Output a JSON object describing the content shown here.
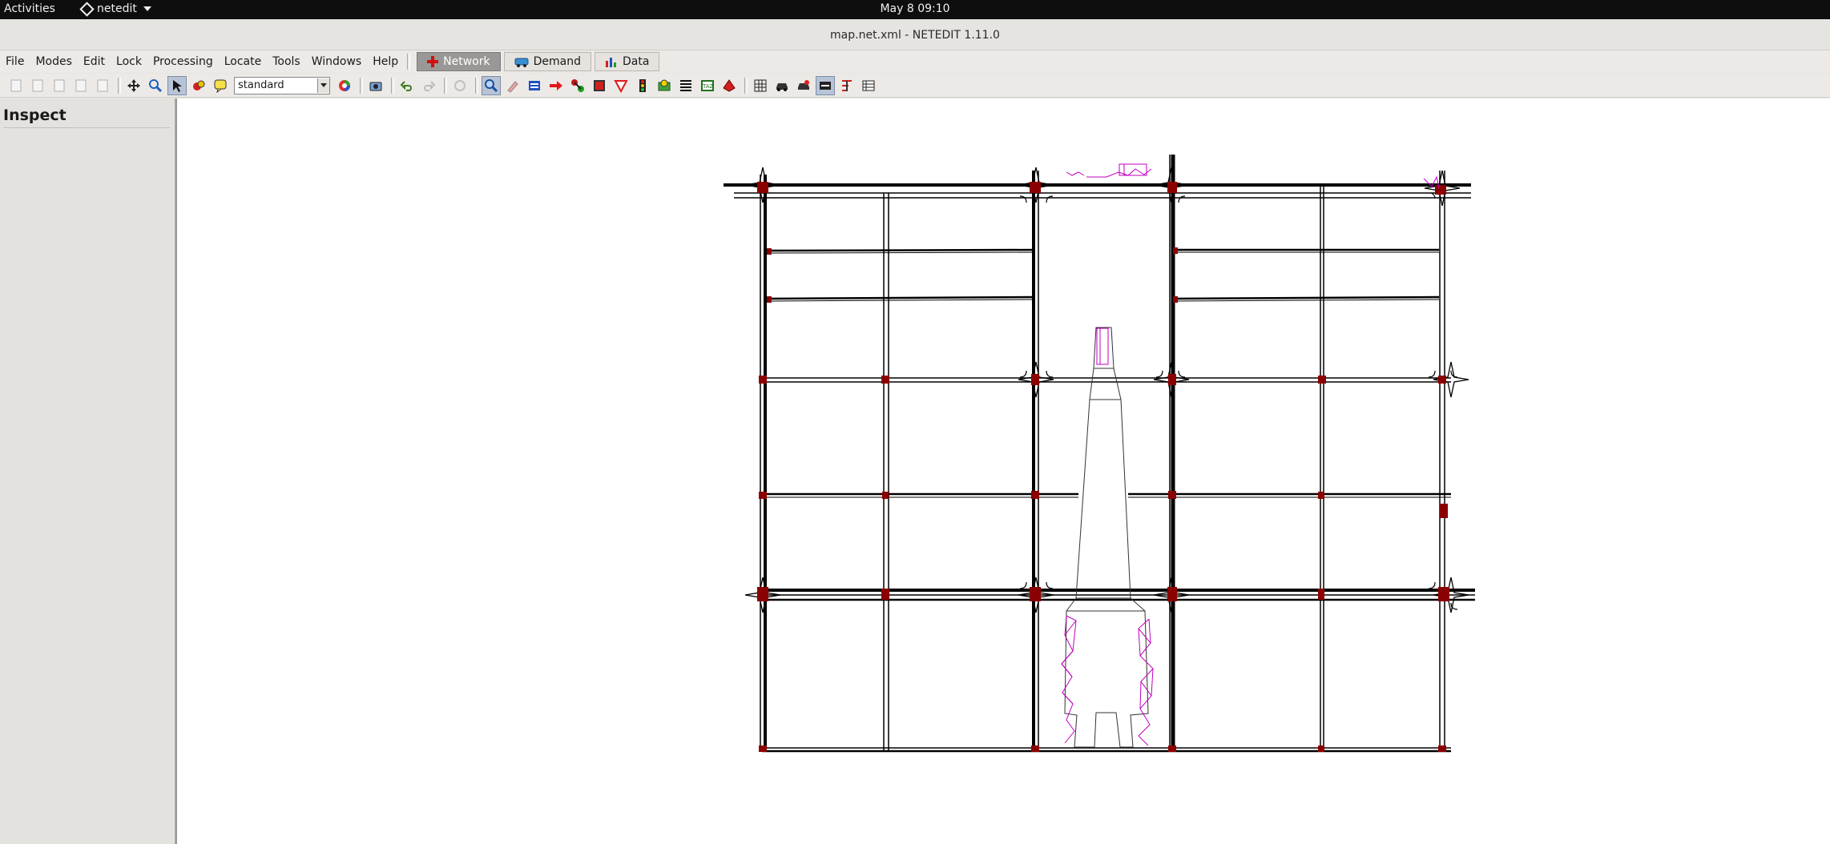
{
  "system_bar": {
    "activities": "Activities",
    "app_name": "netedit",
    "clock": "May 8  09:10"
  },
  "window": {
    "title": "map.net.xml - NETEDIT 1.11.0"
  },
  "menubar": {
    "menus": [
      "File",
      "Modes",
      "Edit",
      "Lock",
      "Processing",
      "Locate",
      "Tools",
      "Windows",
      "Help"
    ],
    "supermodes": [
      {
        "label": "Network",
        "active": true,
        "icon": "network-icon"
      },
      {
        "label": "Demand",
        "active": false,
        "icon": "demand-icon"
      },
      {
        "label": "Data",
        "active": false,
        "icon": "data-icon"
      }
    ]
  },
  "toolbar": {
    "view_scheme": "standard",
    "file_icons": [
      "new-network-icon",
      "open-icon",
      "save-icon",
      "save-as-icon",
      "reload-icon"
    ],
    "nav_icons": [
      "recenter-view-icon",
      "zoom-icon",
      "locate-icon",
      "color-scheme-icon",
      "tooltip-icon"
    ],
    "edit_modes": [
      "inspect-mode-icon",
      "delete-mode-icon",
      "select-mode-icon",
      "move-mode-icon",
      "create-edge-mode-icon",
      "connection-mode-icon",
      "prohibition-mode-icon",
      "traffic-light-mode-icon",
      "additional-mode-icon",
      "crossing-mode-icon",
      "taz-mode-icon",
      "shape-mode-icon",
      "grid-icon",
      "vehicle-icon",
      "vehicle-alt-icon",
      "spread-icon",
      "merge-icon",
      "table-icon"
    ]
  },
  "sidebar": {
    "header": "Inspect"
  },
  "colors": {
    "road_outline": "#000000",
    "junction": "#8b0000",
    "pedestrian": "#c000c0",
    "canvas_bg": "#ffffff"
  }
}
